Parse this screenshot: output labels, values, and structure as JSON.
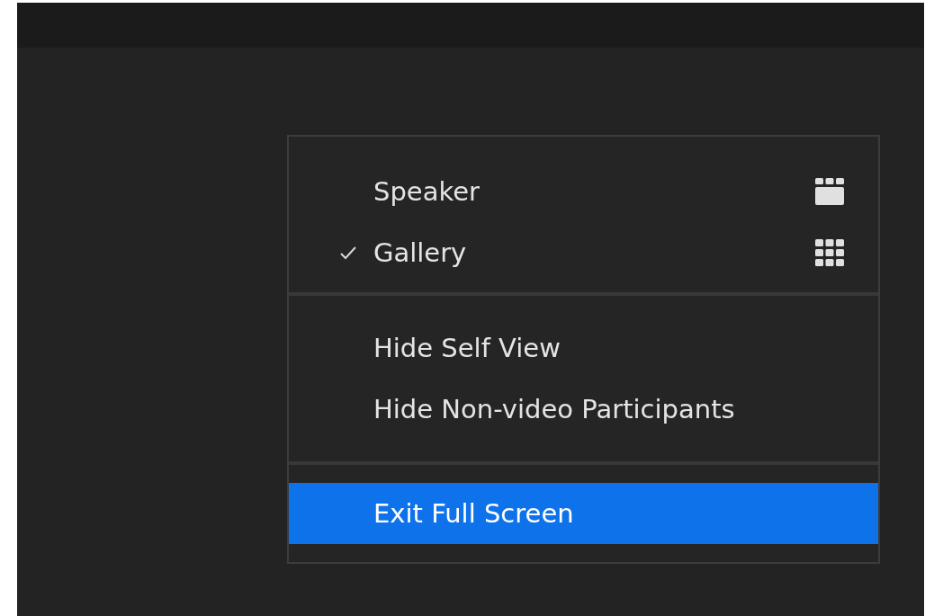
{
  "menu": {
    "sections": [
      {
        "items": [
          {
            "label": "Speaker",
            "kind": "speaker-view",
            "checked": false,
            "selected": false
          },
          {
            "label": "Gallery",
            "kind": "gallery-view",
            "checked": true,
            "selected": false
          }
        ]
      },
      {
        "items": [
          {
            "label": "Hide Self View",
            "kind": "plain",
            "checked": false,
            "selected": false
          },
          {
            "label": "Hide Non-video Participants",
            "kind": "plain",
            "checked": false,
            "selected": false
          }
        ]
      },
      {
        "items": [
          {
            "label": "Exit Full Screen",
            "kind": "plain",
            "checked": false,
            "selected": true
          }
        ]
      }
    ]
  }
}
